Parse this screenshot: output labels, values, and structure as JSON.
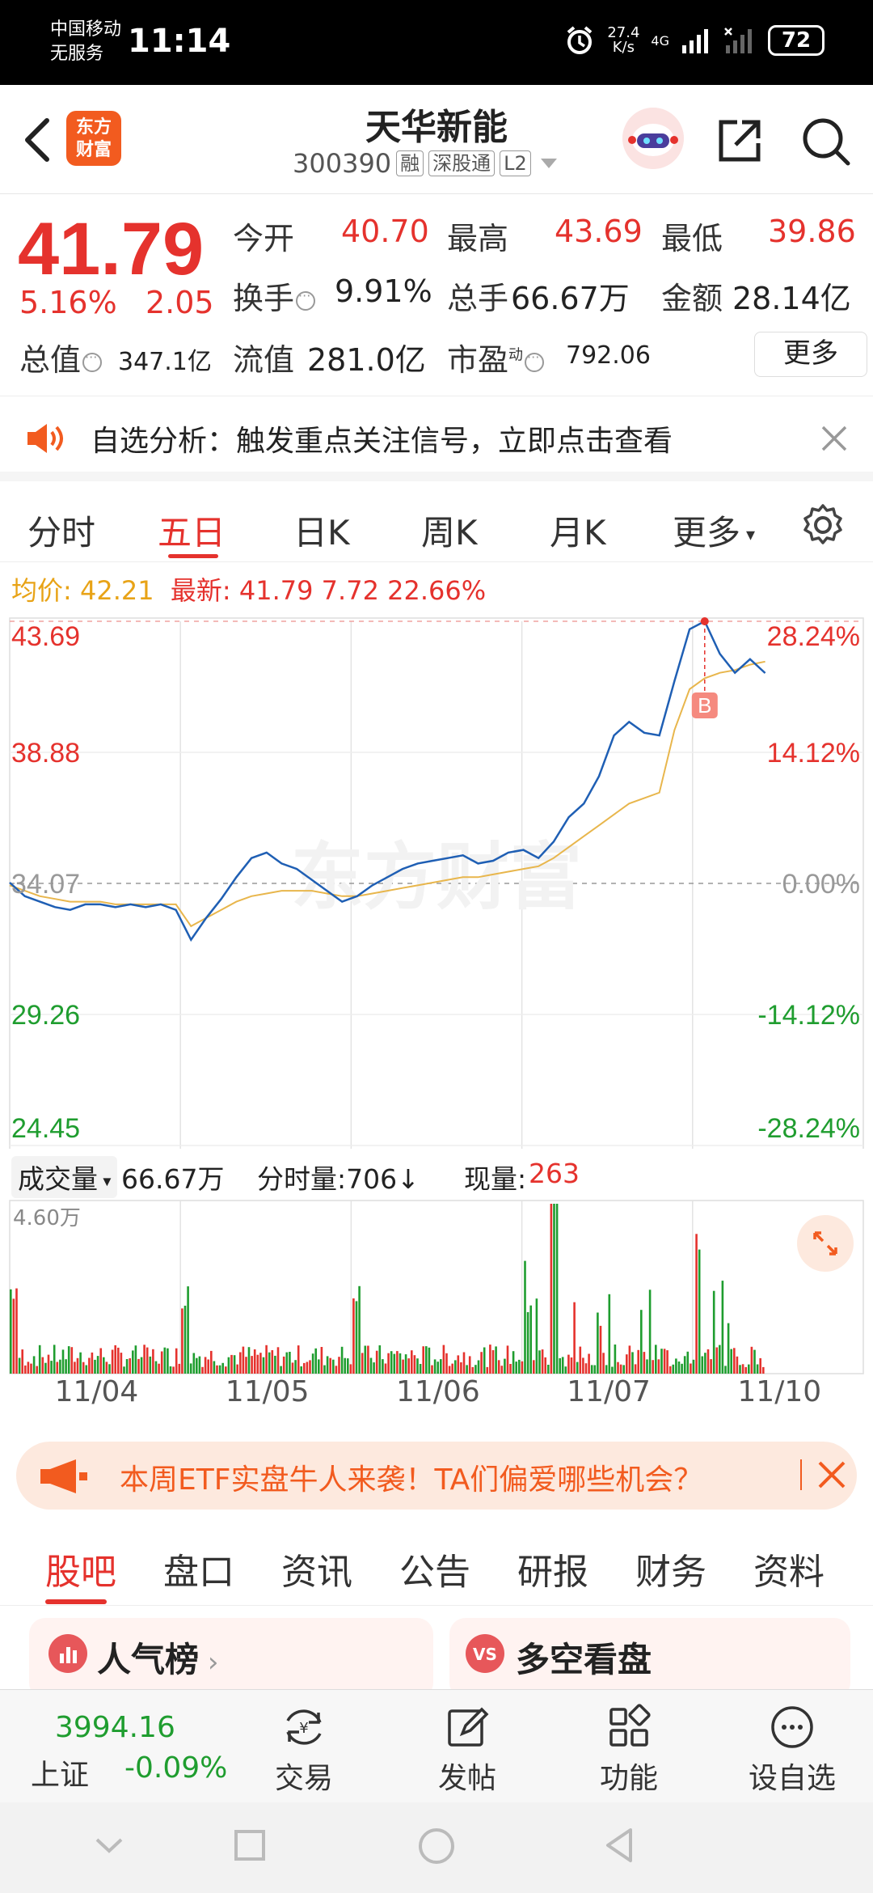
{
  "status_bar": {
    "carrier_line1": "中国移动",
    "carrier_line2": "无服务",
    "time": "11:14",
    "net_speed": "27.4",
    "net_speed_unit": "K/s",
    "network": "4G",
    "battery": "72"
  },
  "header": {
    "logo_line1": "东方",
    "logo_line2": "财富",
    "stock_name": "天华新能",
    "stock_code": "300390",
    "tags": [
      "融",
      "深股通",
      "L2"
    ]
  },
  "quote": {
    "price": "41.79",
    "change_pct": "5.16%",
    "change_val": "2.05",
    "open_label": "今开",
    "open_value": "40.70",
    "high_label": "最高",
    "high_value": "43.69",
    "low_label": "最低",
    "low_value": "39.86",
    "turnover_label": "换手",
    "turnover_value": "9.91%",
    "volume_label": "总手",
    "volume_value": "66.67万",
    "amount_label": "金额",
    "amount_value": "28.14亿",
    "mktcap_label": "总值",
    "mktcap_value": "347.1亿",
    "float_label": "流值",
    "float_value": "281.0亿",
    "pe_label": "市盈",
    "pe_superscript": "动",
    "pe_value": "792.06",
    "more_label": "更多"
  },
  "alert": {
    "text": "自选分析：触发重点关注信号，立即点击查看"
  },
  "period_tabs": [
    "分时",
    "五日",
    "日K",
    "周K",
    "月K",
    "更多"
  ],
  "chart_info": {
    "avg_label": "均价:",
    "avg_value": "42.21",
    "latest_label": "最新:",
    "latest_value": "41.79",
    "change": "7.72",
    "change_pct": "22.66%"
  },
  "chart_data": {
    "type": "line",
    "watermark": "东方财富",
    "marker": "B",
    "y_ticks_left": [
      "43.69",
      "38.88",
      "34.07",
      "29.26",
      "24.45"
    ],
    "y_ticks_right": [
      "28.24%",
      "14.12%",
      "0.00%",
      "-14.12%",
      "-28.24%"
    ],
    "ylim": [
      24.45,
      43.69
    ],
    "base_price": 34.07,
    "x": [
      "11/04",
      "11/05",
      "11/06",
      "11/07",
      "11/10"
    ],
    "series": [
      {
        "values": [
          34.1,
          33.6,
          33.4,
          33.2,
          33.1,
          33.3,
          33.3,
          33.2,
          33.3,
          33.2,
          33.3,
          33.1,
          32.0,
          32.8,
          33.5,
          34.3,
          35.0,
          35.2,
          34.8,
          34.6,
          34.2,
          33.8,
          33.4,
          33.6,
          34.0,
          34.3,
          34.6,
          34.8,
          34.9,
          35.0,
          35.1,
          34.8,
          34.9,
          35.2,
          35.3,
          35.0,
          35.6,
          36.5,
          37.0,
          38.0,
          39.5,
          40.0,
          39.6,
          39.5,
          41.5,
          43.4,
          43.69,
          42.5,
          41.8,
          42.3,
          41.79
        ]
      },
      {
        "values": [
          34.0,
          33.8,
          33.6,
          33.5,
          33.4,
          33.4,
          33.4,
          33.3,
          33.3,
          33.3,
          33.3,
          33.3,
          32.5,
          32.8,
          33.1,
          33.4,
          33.6,
          33.7,
          33.8,
          33.8,
          33.8,
          33.7,
          33.6,
          33.6,
          33.7,
          33.8,
          33.9,
          34.0,
          34.1,
          34.2,
          34.3,
          34.3,
          34.4,
          34.5,
          34.6,
          34.7,
          35.0,
          35.4,
          35.8,
          36.2,
          36.6,
          37.0,
          37.2,
          37.4,
          39.7,
          41.2,
          41.6,
          41.8,
          41.9,
          42.1,
          42.21
        ]
      }
    ]
  },
  "volume": {
    "selector_label": "成交量",
    "total": "66.67万",
    "tick_label": "分时量:706",
    "current_label": "现量:",
    "current_value": "263",
    "max_label": "4.60万"
  },
  "promo": {
    "text": "本周ETF实盘牛人来袭！TA们偏爱哪些机会？"
  },
  "content_tabs": [
    "股吧",
    "盘口",
    "资讯",
    "公告",
    "研报",
    "财务",
    "资料"
  ],
  "cards": [
    {
      "label": "人气榜"
    },
    {
      "label": "多空看盘"
    }
  ],
  "bottom_nav": {
    "index_value": "3994.16",
    "index_name": "上证",
    "index_change": "-0.09%",
    "items": [
      "交易",
      "发帖",
      "功能",
      "设自选"
    ]
  }
}
